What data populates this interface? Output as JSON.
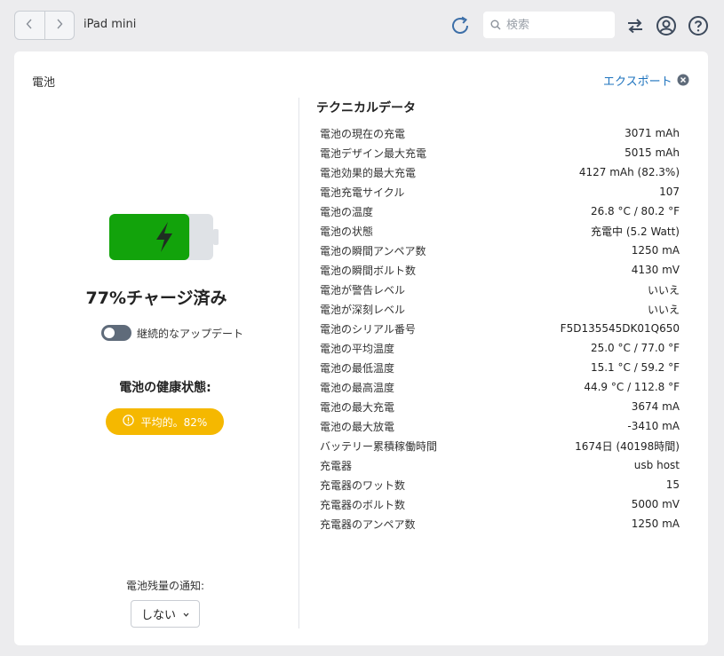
{
  "toolbar": {
    "device_name": "iPad mini",
    "search_placeholder": "検索"
  },
  "panel": {
    "title": "電池",
    "export_label": "エクスポート"
  },
  "battery": {
    "level_percent": 77,
    "charge_text": "77%チャージ済み",
    "fill_color": "#12a30b",
    "toggle_label": "継続的なアップデート",
    "toggle_on": false,
    "health_title": "電池の健康状態:",
    "health_badge": "平均的。82%",
    "health_color": "#f5b800",
    "notify_label": "電池残量の通知:",
    "notify_value": "しない"
  },
  "tech": {
    "title": "テクニカルデータ",
    "rows": [
      {
        "label": "電池の現在の充電",
        "value": "3071 mAh"
      },
      {
        "label": "電池デザイン最大充電",
        "value": "5015 mAh"
      },
      {
        "label": "電池効果的最大充電",
        "value": "4127 mAh (82.3%)"
      },
      {
        "label": "電池充電サイクル",
        "value": "107"
      },
      {
        "label": "電池の温度",
        "value": "26.8 °C / 80.2 °F"
      },
      {
        "label": "電池の状態",
        "value": "充電中 (5.2 Watt)"
      },
      {
        "label": "電池の瞬間アンペア数",
        "value": "1250 mA"
      },
      {
        "label": "電池の瞬間ボルト数",
        "value": "4130 mV"
      },
      {
        "label": "電池が警告レベル",
        "value": "いいえ"
      },
      {
        "label": "電池が深刻レベル",
        "value": "いいえ"
      },
      {
        "label": "電池のシリアル番号",
        "value": "F5D135545DK01Q650"
      },
      {
        "label": "電池の平均温度",
        "value": "25.0 °C / 77.0 °F"
      },
      {
        "label": "電池の最低温度",
        "value": "15.1 °C / 59.2 °F"
      },
      {
        "label": "電池の最高温度",
        "value": "44.9 °C / 112.8 °F"
      },
      {
        "label": "電池の最大充電",
        "value": "3674 mA"
      },
      {
        "label": "電池の最大放電",
        "value": "-3410 mA"
      },
      {
        "label": "バッテリー累積稼働時間",
        "value": "1674日 (40198時間)"
      },
      {
        "label": "充電器",
        "value": "usb host"
      },
      {
        "label": "充電器のワット数",
        "value": "15"
      },
      {
        "label": "充電器のボルト数",
        "value": "5000 mV"
      },
      {
        "label": "充電器のアンペア数",
        "value": "1250 mA"
      }
    ]
  }
}
